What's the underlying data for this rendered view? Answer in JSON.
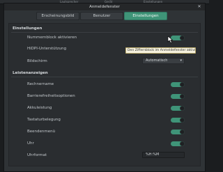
{
  "background": {
    "tabs": [
      "Lautsprecher",
      "Gerät",
      "Einstellungen"
    ]
  },
  "window": {
    "title": "Anmeldefenster",
    "close_icon": "close-icon"
  },
  "tabs": [
    {
      "label": "Erscheinungsbild",
      "active": false
    },
    {
      "label": "Benutzer",
      "active": false
    },
    {
      "label": "Einstellungen",
      "active": true
    }
  ],
  "sections": {
    "einstellungen": {
      "title": "Einstellungen",
      "numlock_label": "Nummernblock aktivieren",
      "hidpi_label": "HiDPI-Unterstützung",
      "screen_label": "Bildschirm",
      "screen_value": "Automatisch"
    },
    "leiste": {
      "title": "Leistenanzeigen",
      "items": [
        {
          "label": "Rechnername",
          "on": true
        },
        {
          "label": "Barrierefreiheitsoptionen",
          "on": true
        },
        {
          "label": "Akkuleistung",
          "on": true
        },
        {
          "label": "Tastaturbelegung",
          "on": true
        },
        {
          "label": "Beendenmenü",
          "on": true
        },
        {
          "label": "Uhr",
          "on": true
        }
      ],
      "clock_format_label": "Uhrformat",
      "clock_format_value": "%H:%M"
    }
  },
  "tooltip": "Den Ziffernblock im Anmeldefenster aktivieren.",
  "colors": {
    "accent": "#3f9478",
    "window_bg": "#2f3336",
    "tooltip_bg": "#f4f0dd"
  }
}
